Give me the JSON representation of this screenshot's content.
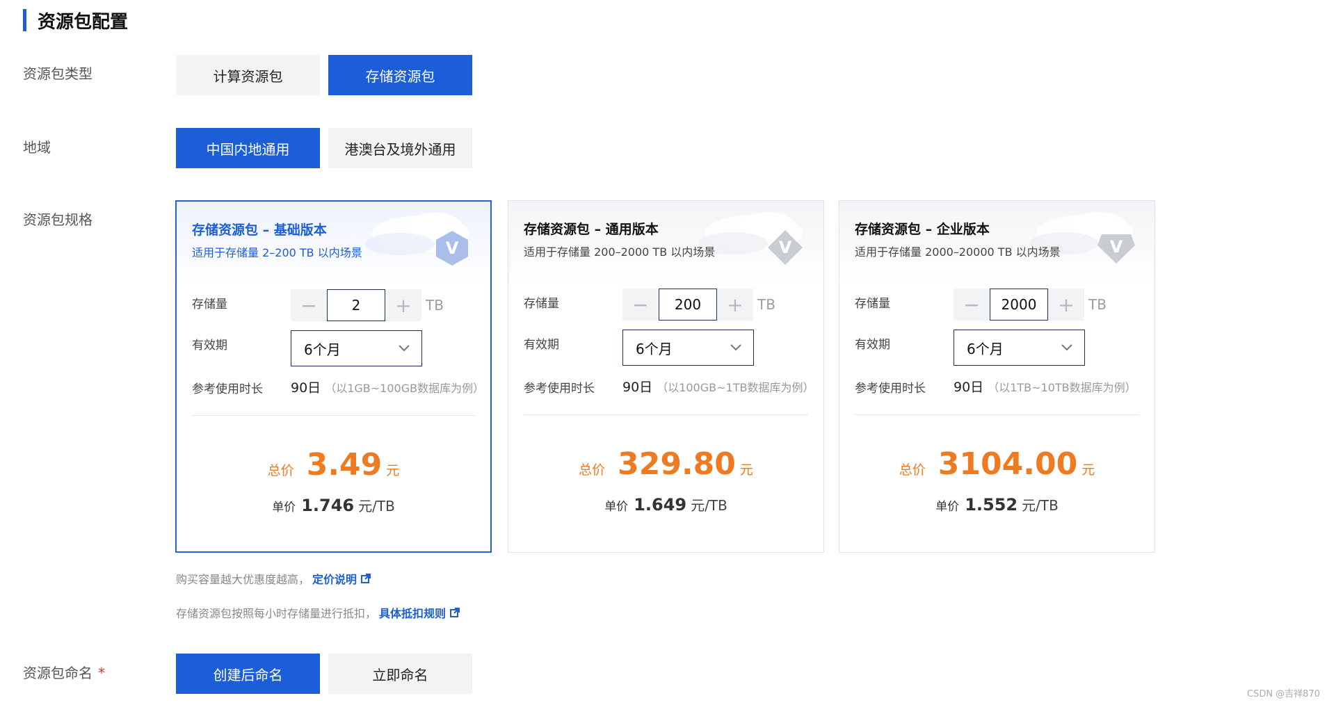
{
  "section": {
    "title": "资源包配置"
  },
  "rows": {
    "type_label": "资源包类型",
    "region_label": "地域",
    "spec_label": "资源包规格",
    "name_label": "资源包命名",
    "required_mark": "*"
  },
  "type_options": [
    "计算资源包",
    "存储资源包"
  ],
  "type_selected": "存储资源包",
  "region_options": [
    "中国内地通用",
    "港澳台及境外通用"
  ],
  "region_selected": "中国内地通用",
  "cards": [
    {
      "title": "存储资源包 – 基础版本",
      "subtitle": "适用于存储量 2–200 TB 以内场景",
      "badge_icon": "v-badge-icon",
      "storage_label": "存储量",
      "storage_value": "2",
      "storage_unit": "TB",
      "validity_label": "有效期",
      "validity_value": "6个月",
      "ref_label": "参考使用时长",
      "ref_value": "90日",
      "ref_note": "（以1GB~100GB数据库为例）",
      "total_label": "总价",
      "total_value": "3.49",
      "total_currency": "元",
      "unit_label": "单价",
      "unit_value": "1.746",
      "unit_unit": "元/TB",
      "selected": true
    },
    {
      "title": "存储资源包 – 通用版本",
      "subtitle": "适用于存储量 200–2000 TB 以内场景",
      "badge_icon": "v-badge-icon",
      "storage_label": "存储量",
      "storage_value": "200",
      "storage_unit": "TB",
      "validity_label": "有效期",
      "validity_value": "6个月",
      "ref_label": "参考使用时长",
      "ref_value": "90日",
      "ref_note": "（以100GB~1TB数据库为例）",
      "total_label": "总价",
      "total_value": "329.80",
      "total_currency": "元",
      "unit_label": "单价",
      "unit_value": "1.649",
      "unit_unit": "元/TB",
      "selected": false
    },
    {
      "title": "存储资源包 – 企业版本",
      "subtitle": "适用于存储量 2000–20000 TB 以内场景",
      "badge_icon": "v-badge-icon",
      "storage_label": "存储量",
      "storage_value": "2000",
      "storage_unit": "TB",
      "validity_label": "有效期",
      "validity_value": "6个月",
      "ref_label": "参考使用时长",
      "ref_value": "90日",
      "ref_note": "（以1TB~10TB数据库为例）",
      "total_label": "总价",
      "total_value": "3104.00",
      "total_currency": "元",
      "unit_label": "单价",
      "unit_value": "1.552",
      "unit_unit": "元/TB",
      "selected": false
    }
  ],
  "hints": [
    {
      "text": "购买容量越大优惠度越高，",
      "link": "定价说明"
    },
    {
      "text": "存储资源包按照每小时存储量进行抵扣，",
      "link": "具体抵扣规则"
    }
  ],
  "name_options": [
    "创建后命名",
    "立即命名"
  ],
  "name_selected": "创建后命名",
  "watermark": "CSDN @吉祥870",
  "colors": {
    "primary": "#1c5ed8",
    "price": "#ee7a22",
    "required": "#e5322d"
  }
}
